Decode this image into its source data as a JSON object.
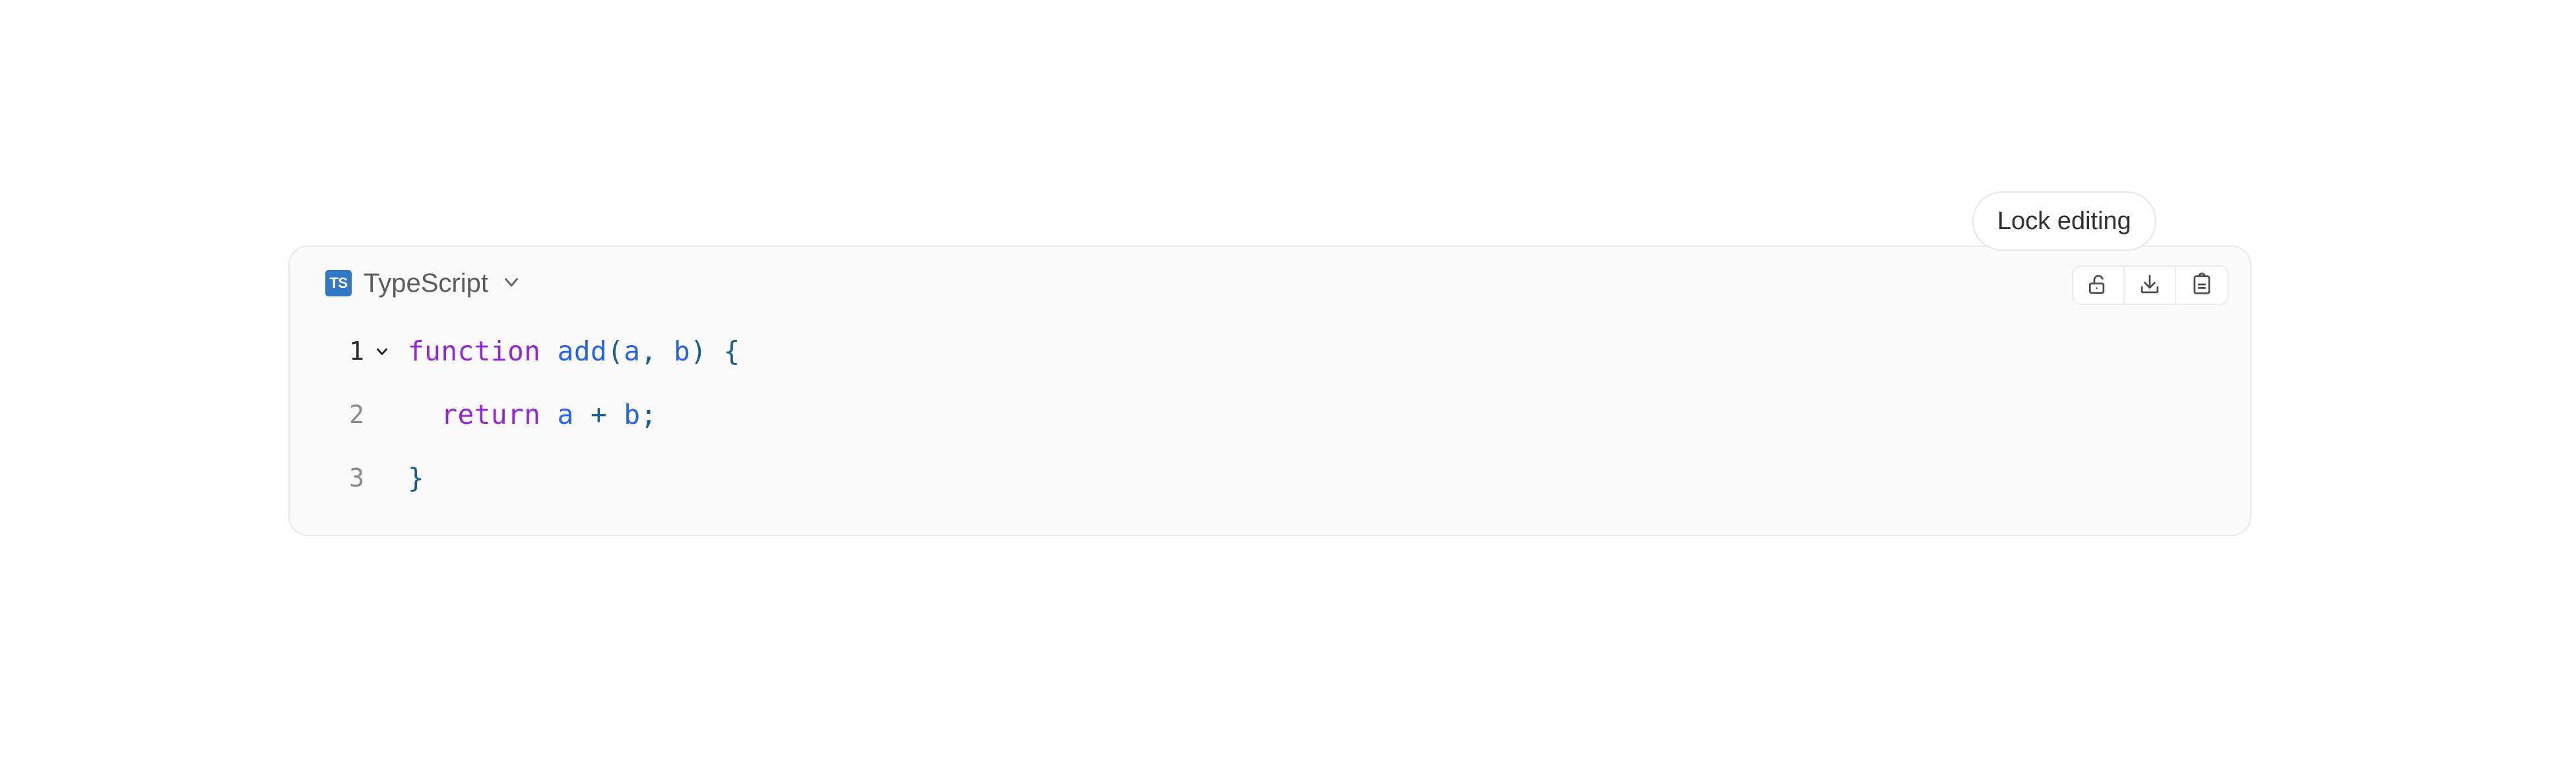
{
  "card": {
    "language": {
      "badge_text": "TS",
      "badge_color": "#3178c6",
      "label": "TypeScript",
      "chevron_icon": "chevron-down-icon"
    },
    "toolbar": {
      "buttons": [
        {
          "name": "lock-editing-button",
          "icon": "unlock-icon",
          "tooltip": "Lock editing"
        },
        {
          "name": "download-button",
          "icon": "download-icon",
          "tooltip": "Download"
        },
        {
          "name": "copy-button",
          "icon": "clipboard-icon",
          "tooltip": "Copy"
        }
      ]
    },
    "tooltip": {
      "text": "Lock editing"
    },
    "code": {
      "lines": [
        {
          "number": "1",
          "foldable": true,
          "tokens": [
            {
              "t": "function",
              "c": "kw"
            },
            {
              "t": " ",
              "c": "plain"
            },
            {
              "t": "add",
              "c": "fn"
            },
            {
              "t": "(",
              "c": "punc"
            },
            {
              "t": "a",
              "c": "var"
            },
            {
              "t": ", ",
              "c": "punc"
            },
            {
              "t": "b",
              "c": "var"
            },
            {
              "t": ") ",
              "c": "punc"
            },
            {
              "t": "{",
              "c": "punc"
            }
          ]
        },
        {
          "number": "2",
          "foldable": false,
          "tokens": [
            {
              "t": "  ",
              "c": "plain"
            },
            {
              "t": "return",
              "c": "kw"
            },
            {
              "t": " ",
              "c": "plain"
            },
            {
              "t": "a",
              "c": "var"
            },
            {
              "t": " ",
              "c": "plain"
            },
            {
              "t": "+",
              "c": "op"
            },
            {
              "t": " ",
              "c": "plain"
            },
            {
              "t": "b",
              "c": "var"
            },
            {
              "t": ";",
              "c": "punc"
            }
          ]
        },
        {
          "number": "3",
          "foldable": false,
          "tokens": [
            {
              "t": "}",
              "c": "punc"
            }
          ]
        }
      ]
    }
  },
  "colors": {
    "page_background": "#ffffff",
    "card_background": "#fbfbfc",
    "card_border": "#e9e9ed",
    "keyword": "#9326dd",
    "identifier": "#2563eb",
    "punctuation": "#1a5c8f"
  }
}
